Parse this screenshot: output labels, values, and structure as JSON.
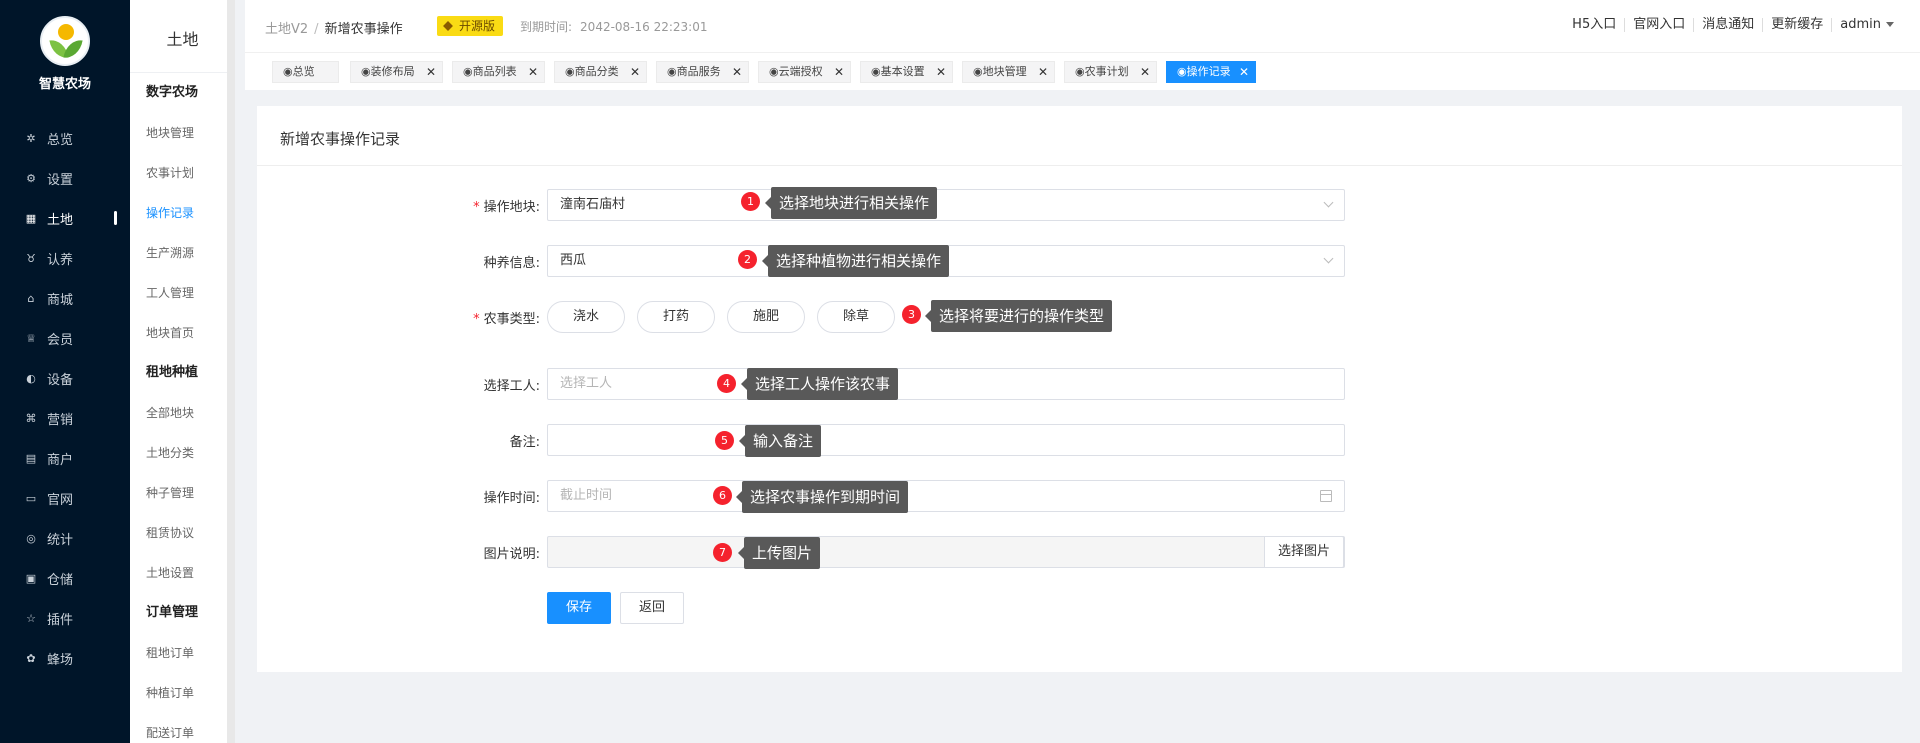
{
  "brand": {
    "name": "智慧农场"
  },
  "nav1": [
    {
      "label": "总览",
      "icon": "dashboard-icon"
    },
    {
      "label": "设置",
      "icon": "gear-icon"
    },
    {
      "label": "土地",
      "icon": "grid-icon",
      "active": true
    },
    {
      "label": "认养",
      "icon": "tree-icon"
    },
    {
      "label": "商城",
      "icon": "shop-icon"
    },
    {
      "label": "会员",
      "icon": "member-icon"
    },
    {
      "label": "设备",
      "icon": "device-icon"
    },
    {
      "label": "营销",
      "icon": "marketing-icon"
    },
    {
      "label": "商户",
      "icon": "merchant-icon"
    },
    {
      "label": "官网",
      "icon": "website-icon"
    },
    {
      "label": "统计",
      "icon": "stats-icon"
    },
    {
      "label": "仓储",
      "icon": "warehouse-icon"
    },
    {
      "label": "插件",
      "icon": "star-icon"
    },
    {
      "label": "蜂场",
      "icon": "bee-icon"
    }
  ],
  "side2": {
    "title": "土地",
    "groups": [
      {
        "title": "数字农场",
        "items": [
          "地块管理",
          "农事计划",
          "操作记录",
          "生产溯源",
          "工人管理",
          "地块首页"
        ]
      },
      {
        "title": "租地种植",
        "items": [
          "全部地块",
          "土地分类",
          "种子管理",
          "租赁协议",
          "土地设置"
        ]
      },
      {
        "title": "订单管理",
        "items": [
          "租地订单",
          "种植订单",
          "配送订单"
        ]
      }
    ],
    "active": "操作记录"
  },
  "header": {
    "crumb_root": "土地V2",
    "crumb_sep": "/",
    "crumb_current": "新增农事操作",
    "badge": "开源版",
    "expire_label": "到期时间:",
    "expire_value": "2042-08-16 22:23:01",
    "links": [
      "H5入口",
      "官网入口",
      "消息通知",
      "更新缓存",
      "admin"
    ]
  },
  "tabs": [
    {
      "label": "◉总览",
      "closable": false
    },
    {
      "label": "◉装修布局",
      "closable": true
    },
    {
      "label": "◉商品列表",
      "closable": true
    },
    {
      "label": "◉商品分类",
      "closable": true
    },
    {
      "label": "◉商品服务",
      "closable": true
    },
    {
      "label": "◉云端授权",
      "closable": true
    },
    {
      "label": "◉基本设置",
      "closable": true
    },
    {
      "label": "◉地块管理",
      "closable": true
    },
    {
      "label": "◉农事计划",
      "closable": true
    },
    {
      "label": "◉操作记录",
      "closable": true,
      "active": true
    }
  ],
  "tab_close": "✕",
  "form": {
    "title": "新增农事操作记录",
    "plot_label": "操作地块:",
    "plot_value": "潼南石庙村",
    "plant_label": "种养信息:",
    "plant_value": "西瓜",
    "type_label": "农事类型:",
    "types": [
      "浇水",
      "打药",
      "施肥",
      "除草"
    ],
    "worker_label": "选择工人:",
    "worker_placeholder": "选择工人",
    "note_label": "备注:",
    "note_value": "",
    "time_label": "操作时间:",
    "time_placeholder": "截止时间",
    "image_label": "图片说明:",
    "image_button": "选择图片",
    "save": "保存",
    "back": "返回",
    "required_mark": "*"
  },
  "tips": [
    {
      "num": "1",
      "text": "选择地块进行相关操作"
    },
    {
      "num": "2",
      "text": "选择种植物进行相关操作"
    },
    {
      "num": "3",
      "text": "选择将要进行的操作类型"
    },
    {
      "num": "4",
      "text": "选择工人操作该农事"
    },
    {
      "num": "5",
      "text": "输入备注"
    },
    {
      "num": "6",
      "text": "选择农事操作到期时间"
    },
    {
      "num": "7",
      "text": "上传图片"
    }
  ],
  "colors": {
    "sidebar": "#001529",
    "primary": "#1890ff",
    "badge": "#fadb14",
    "marker": "#f5222d",
    "tooltip": "#595959"
  }
}
